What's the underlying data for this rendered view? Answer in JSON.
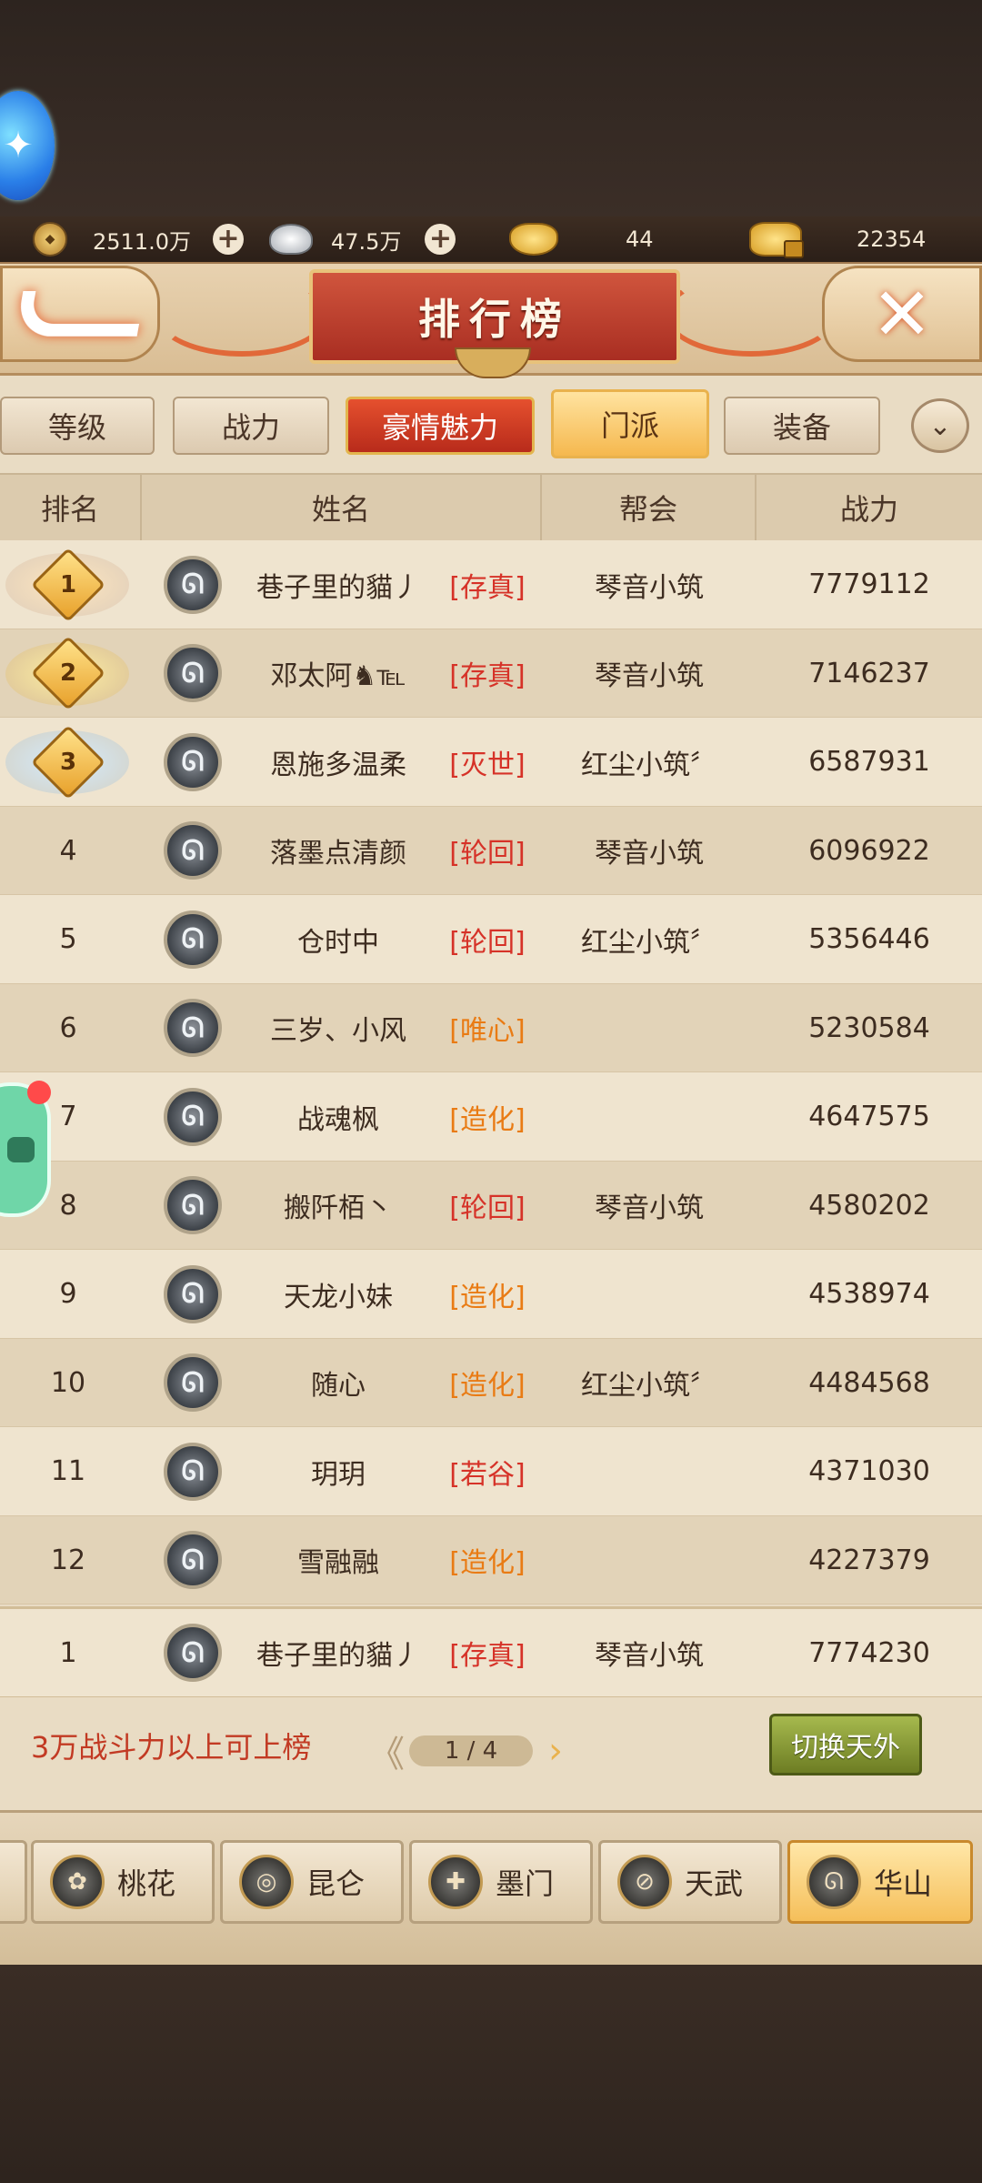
{
  "currency": {
    "copper": "2511.0万",
    "silver": "47.5万",
    "gold": "44",
    "bound_gold": "22354"
  },
  "header": {
    "title": "排行榜"
  },
  "tabs": [
    {
      "label": "等级"
    },
    {
      "label": "战力"
    },
    {
      "label": "豪情魅力"
    },
    {
      "label": "门派"
    },
    {
      "label": "装备"
    }
  ],
  "table": {
    "headers": {
      "rank": "排名",
      "name": "姓名",
      "guild": "帮会",
      "power": "战力"
    },
    "rows": [
      {
        "rank": "1",
        "name": "巷子里的貓丿",
        "faction": "[存真]",
        "guild": "琴音小筑",
        "power": "7779112"
      },
      {
        "rank": "2",
        "name": "邓太阿♞℡",
        "faction": "[存真]",
        "guild": "琴音小筑",
        "power": "7146237"
      },
      {
        "rank": "3",
        "name": "恩施多温柔",
        "faction": "[灭世]",
        "guild": "红尘小筑〞",
        "power": "6587931"
      },
      {
        "rank": "4",
        "name": "落墨点清颜",
        "faction": "[轮回]",
        "guild": "琴音小筑",
        "power": "6096922"
      },
      {
        "rank": "5",
        "name": "仓时中",
        "faction": "[轮回]",
        "guild": "红尘小筑〞",
        "power": "5356446"
      },
      {
        "rank": "6",
        "name": "三岁、小风",
        "faction": "[唯心]",
        "guild": "",
        "power": "5230584"
      },
      {
        "rank": "7",
        "name": "战魂枫",
        "faction": "[造化]",
        "guild": "",
        "power": "4647575"
      },
      {
        "rank": "8",
        "name": "搬阡栢丶",
        "faction": "[轮回]",
        "guild": "琴音小筑",
        "power": "4580202"
      },
      {
        "rank": "9",
        "name": "天龙小妹",
        "faction": "[造化]",
        "guild": "",
        "power": "4538974"
      },
      {
        "rank": "10",
        "name": "随心",
        "faction": "[造化]",
        "guild": "红尘小筑〞",
        "power": "4484568"
      },
      {
        "rank": "11",
        "name": "玥玥",
        "faction": "[若谷]",
        "guild": "",
        "power": "4371030"
      },
      {
        "rank": "12",
        "name": "雪融融",
        "faction": "[造化]",
        "guild": "",
        "power": "4227379"
      }
    ],
    "self": {
      "rank": "1",
      "name": "巷子里的貓丿",
      "faction": "[存真]",
      "guild": "琴音小筑",
      "power": "7774230"
    }
  },
  "footer": {
    "requirement": "3万战斗力以上可上榜",
    "page": "1 / 4",
    "switch_label": "切换天外"
  },
  "sects": [
    {
      "label": "桃花"
    },
    {
      "label": "昆仑"
    },
    {
      "label": "墨门"
    },
    {
      "label": "天武"
    },
    {
      "label": "华山"
    }
  ],
  "colors": {
    "faction_red": "#d63228",
    "faction_orange": "#e97b14",
    "charm_tab": "#c8341f",
    "active_tab": "#f5b84e"
  }
}
